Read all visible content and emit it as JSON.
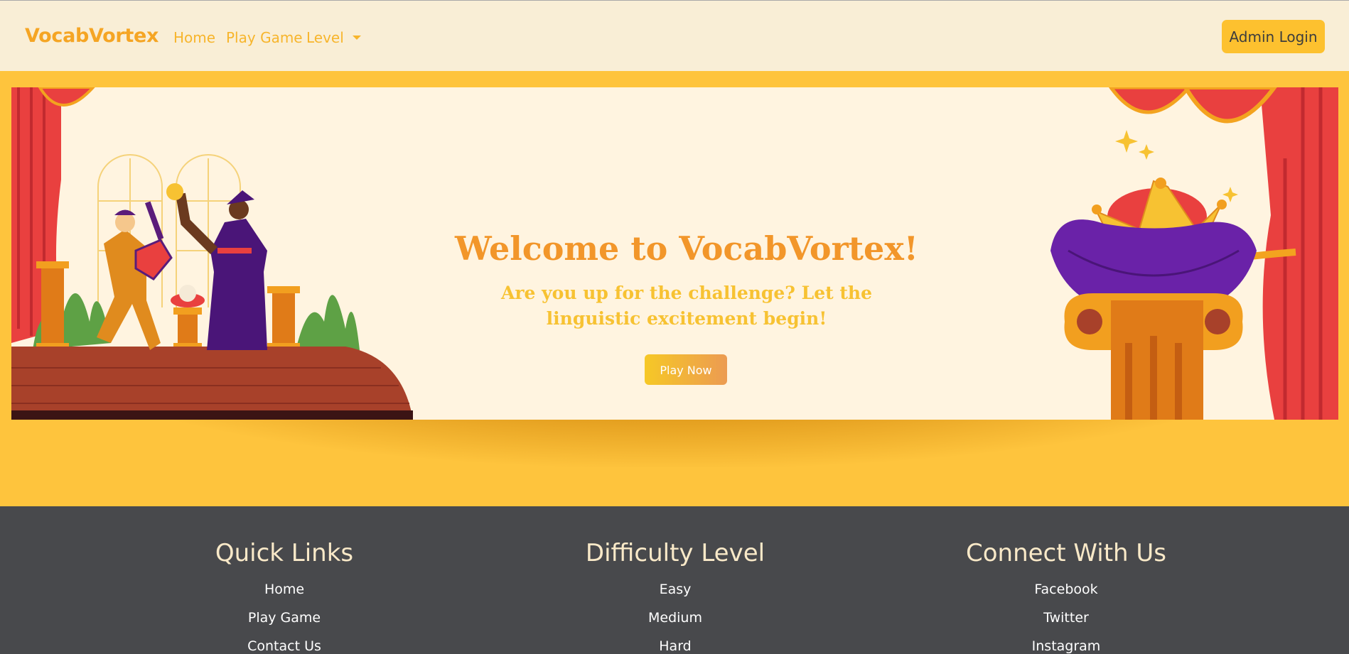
{
  "nav": {
    "brand": "VocabVortex",
    "links": [
      "Home",
      "Play Game",
      "Level"
    ],
    "admin_button": "Admin Login"
  },
  "hero": {
    "title": "Welcome to VocabVortex!",
    "subtitle": "Are you up for the challenge? Let the linguistic excitement begin!",
    "play_button": "Play Now"
  },
  "footer": {
    "columns": [
      {
        "heading": "Quick Links",
        "links": [
          "Home",
          "Play Game",
          "Contact Us"
        ]
      },
      {
        "heading": "Difficulty Level",
        "links": [
          "Easy",
          "Medium",
          "Hard"
        ]
      },
      {
        "heading": "Connect With Us",
        "links": [
          "Facebook",
          "Twitter",
          "Instagram"
        ]
      }
    ]
  },
  "colors": {
    "navbar_bg": "#f9eed6",
    "brand": "#f5a524",
    "band": "#fec43d",
    "banner_bg": "#fff4e0",
    "footer_bg": "#48494c",
    "footer_heading": "#f9e9c8"
  }
}
